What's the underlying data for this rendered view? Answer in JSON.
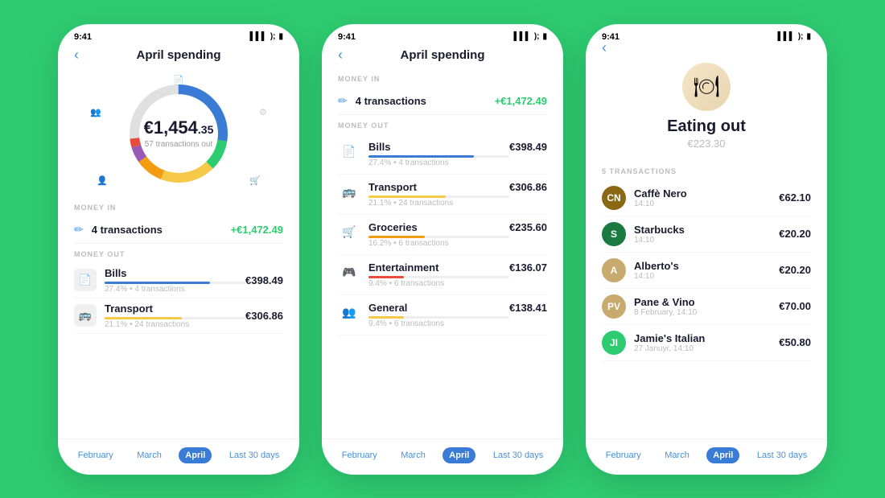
{
  "phones": [
    {
      "id": "phone1",
      "statusTime": "9:41",
      "header": {
        "title": "April spending",
        "backBtn": "‹"
      },
      "donut": {
        "amount": "€1,454",
        "cents": ".35",
        "label": "57 transactions out",
        "segments": [
          {
            "color": "#3a7bd5",
            "pct": 27
          },
          {
            "color": "#2ecc71",
            "pct": 10
          },
          {
            "color": "#f7c948",
            "pct": 18
          },
          {
            "color": "#f39c12",
            "pct": 9
          },
          {
            "color": "#9b59b6",
            "pct": 5
          },
          {
            "color": "#e74c3c",
            "pct": 16
          },
          {
            "color": "#95a5a6",
            "pct": 8
          },
          {
            "color": "#1abc9c",
            "pct": 5
          },
          {
            "color": "#e0e0e0",
            "pct": 2
          }
        ]
      },
      "moneyIn": {
        "label": "MONEY IN",
        "transactions": "4 transactions",
        "amount": "+€1,472.49",
        "icon": "✏"
      },
      "moneyOut": {
        "label": "MONEY OUT",
        "categories": [
          {
            "name": "Bills",
            "amount": "€398.49",
            "sub": "27.4% • 4 transactions",
            "color": "#3a7bd5",
            "pct": 75,
            "icon": "📄"
          },
          {
            "name": "Transport",
            "amount": "€306.86",
            "sub": "21.1% • 24 transactions",
            "color": "#f7c948",
            "pct": 55,
            "icon": "🚌"
          }
        ]
      },
      "tabs": [
        {
          "label": "February",
          "active": false
        },
        {
          "label": "March",
          "active": false
        },
        {
          "label": "April",
          "active": true
        },
        {
          "label": "Last 30 days",
          "active": false
        }
      ]
    },
    {
      "id": "phone2",
      "statusTime": "9:41",
      "header": {
        "title": "April spending",
        "backBtn": "‹"
      },
      "moneyIn": {
        "label": "MONEY IN",
        "transactions": "4 transactions",
        "amount": "+€1,472.49",
        "icon": "✏"
      },
      "moneyOut": {
        "label": "MONEY OUT",
        "categories": [
          {
            "name": "Bills",
            "amount": "€398.49",
            "sub": "27.4% • 4 transactions",
            "color": "#3a7bd5",
            "pct": 75,
            "icon": "📄"
          },
          {
            "name": "Transport",
            "amount": "€306.86",
            "sub": "21.1% • 24 transactions",
            "color": "#f7c948",
            "pct": 55,
            "icon": "🚌"
          },
          {
            "name": "Groceries",
            "amount": "€235.60",
            "sub": "16.2% • 6 transactions",
            "color": "#f39c12",
            "pct": 40,
            "icon": "🛒"
          },
          {
            "name": "Entertainment",
            "amount": "€136.07",
            "sub": "9.4% • 6 transactions",
            "color": "#e74c3c",
            "pct": 25,
            "icon": "🎮"
          },
          {
            "name": "General",
            "amount": "€138.41",
            "sub": "9.4% • 6 transactions",
            "color": "#f7c948",
            "pct": 25,
            "icon": "👥"
          }
        ]
      },
      "tabs": [
        {
          "label": "February",
          "active": false
        },
        {
          "label": "March",
          "active": false
        },
        {
          "label": "April",
          "active": true
        },
        {
          "label": "Last 30 days",
          "active": false
        }
      ]
    },
    {
      "id": "phone3",
      "statusTime": "9:41",
      "header": {
        "title": "",
        "backBtn": "‹"
      },
      "eatingOut": {
        "title": "Eating out",
        "amount": "€223.30",
        "countLabel": "5 TRANSACTIONS",
        "merchants": [
          {
            "name": "Caffè Nero",
            "time": "14:10",
            "amount": "€62.10",
            "color": "#8B6914",
            "initials": "CN"
          },
          {
            "name": "Starbucks",
            "time": "14:10",
            "amount": "€20.20",
            "color": "#1a7a3f",
            "initials": "S"
          },
          {
            "name": "Alberto's",
            "time": "14:10",
            "amount": "€20.20",
            "color": "#c8a96e",
            "initials": "A"
          },
          {
            "name": "Pane & Vino",
            "time": "8 February, 14:10",
            "amount": "€70.00",
            "color": "#c8a96e",
            "initials": "PV"
          },
          {
            "name": "Jamie's Italian",
            "time": "27 Januyr, 14:10",
            "amount": "€50.80",
            "color": "#2ecc71",
            "initials": "JI"
          }
        ]
      },
      "tabs": [
        {
          "label": "February",
          "active": false
        },
        {
          "label": "March",
          "active": false
        },
        {
          "label": "April",
          "active": true
        },
        {
          "label": "Last 30 days",
          "active": false
        }
      ]
    }
  ]
}
